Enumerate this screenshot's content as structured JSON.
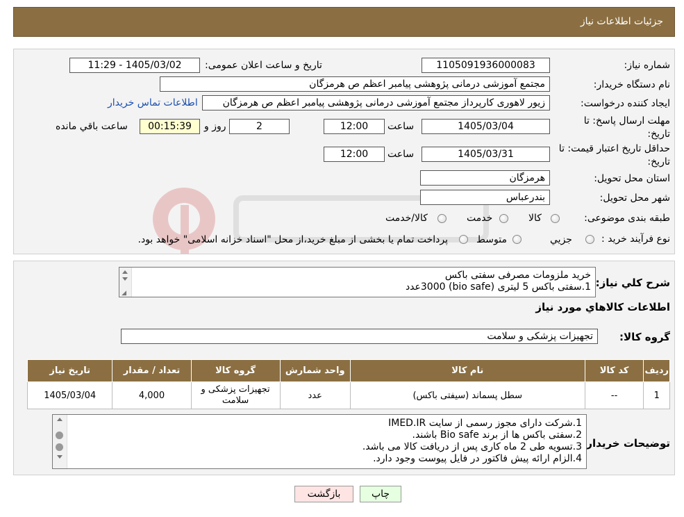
{
  "header": {
    "title": "جزئیات اطلاعات نیاز"
  },
  "details": {
    "need_number_label": "شماره نیاز:",
    "need_number": "1105091936000083",
    "announce_label": "تاریخ و ساعت اعلان عمومی:",
    "announce_value": "1405/03/02 - 11:29",
    "buyer_org_label": "نام دستگاه خریدار:",
    "buyer_org": "مجتمع آموزشی درمانی پژوهشی پیامبر اعظم ص  هرمزگان",
    "creator_label": "ایجاد کننده درخواست:",
    "creator": "زیور لاهوری کارپرداز مجتمع آموزشی درمانی پژوهشی پیامبر اعظم ص  هرمزگان",
    "contact_link": "اطلاعات تماس خریدار",
    "reply_deadline_label_1": "مهلت ارسال پاسخ: تا",
    "reply_deadline_label_2": "تاریخ:",
    "reply_date": "1405/03/04",
    "time_label": "ساعت",
    "reply_time": "12:00",
    "days_value": "2",
    "days_label": "روز و",
    "remaining_time": "00:15:39",
    "remaining_label": "ساعت باقي مانده",
    "validity_label_1": "حداقل تاریخ اعتبار قیمت: تا",
    "validity_label_2": "تاریخ:",
    "validity_date": "1405/03/31",
    "validity_time": "12:00",
    "province_label": "استان محل تحویل:",
    "province": "هرمزگان",
    "city_label": "شهر محل تحویل:",
    "city": "بندرعباس",
    "category_label": "طبقه بندی موضوعی:",
    "category_options": [
      "کالا",
      "خدمت",
      "کالا/خدمت"
    ],
    "process_label": "نوع فرآیند خرید :",
    "process_options": [
      "جزیي",
      "متوسط"
    ],
    "process_note": "پرداخت تمام یا بخشی از مبلغ خرید،از محل \"اسناد خزانه اسلامی\" خواهد بود."
  },
  "summary": {
    "general_desc_label": "شرح کلي نیاز:",
    "general_desc_lines": [
      "خرید ملزومات مصرفی سفتی باکس",
      "1.سفتی باکس 5 لیتری  (bio safe)     3000عدد"
    ],
    "goods_info_title": "اطلاعات کالاهاي مورد نیاز",
    "goods_group_label": "گروه کالا:",
    "goods_group": "تجهیزات پزشکی و سلامت"
  },
  "table": {
    "headers": [
      "ردیف",
      "کد کالا",
      "نام کالا",
      "واحد شمارش",
      "گروه کالا",
      "تعداد / مقدار",
      "تاریخ نیاز"
    ],
    "rows": [
      {
        "row": "1",
        "code": "--",
        "name": "سطل پسماند (سیفتی باکس)",
        "unit": "عدد",
        "group": "تجهیزات پزشکی و سلامت",
        "qty": "4,000",
        "date": "1405/03/04"
      }
    ]
  },
  "buyer_notes": {
    "label": "توضیحات خریدار:",
    "lines": [
      "1.شرکت دارای مجوز رسمی از سایت IMED.IR",
      "2.سفتی باکس ها از برند Bio safe  باشند.",
      "3.تسویه طی  2 ماه کاری پس از دریافت کالا می باشد.",
      "4.الزام ارائه پیش فاکتور در فایل پیوست وجود دارد."
    ]
  },
  "buttons": {
    "print": "چاپ",
    "back": "بازگشت"
  },
  "colors": {
    "header": "#8b6f42",
    "print_button": "#e6ffe0",
    "back_button": "#ffe4e4",
    "link": "#1a4fb0"
  }
}
